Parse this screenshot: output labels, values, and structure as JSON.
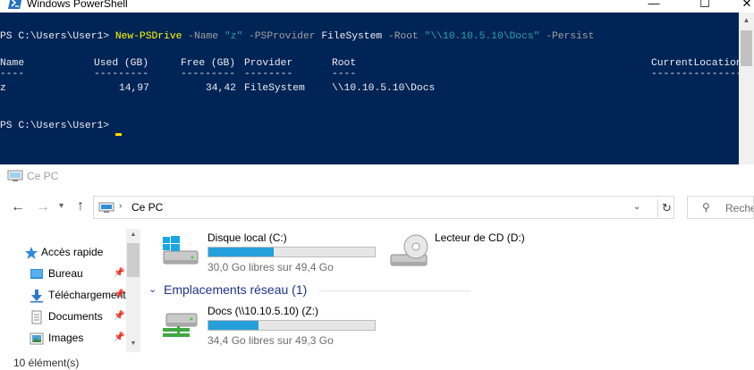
{
  "powershell": {
    "title": "Windows PowerShell",
    "window_buttons": {
      "minimize": "—",
      "maximize": "☐",
      "close": "✕"
    },
    "prompt": "PS C:\\Users\\User1>",
    "command": {
      "cmdlet": "New-PSDrive",
      "p1": "-Name",
      "v1": "\"z\"",
      "p2": "-PSProvider",
      "v2": "FileSystem",
      "p3": "-Root",
      "v3": "\"\\\\10.10.5.10\\Docs\"",
      "p4": "-Persist"
    },
    "table": {
      "headers": [
        "Name",
        "Used (GB)",
        "Free (GB)",
        "Provider",
        "Root",
        "CurrentLocation"
      ],
      "separators": [
        "----",
        "---------",
        "---------",
        "--------",
        "----",
        "---------------"
      ],
      "row": [
        "z",
        "14,97",
        "34,42",
        "FileSystem",
        "\\\\10.10.5.10\\Docs",
        ""
      ]
    },
    "prompt2": "PS C:\\Users\\User1>"
  },
  "explorer": {
    "title": "Ce PC",
    "address": {
      "path": "Ce PC"
    },
    "search": {
      "placeholder": "Rechercher dans : Ce PC"
    },
    "nav": [
      {
        "label": "Accès rapide",
        "icon": "star-icon",
        "pinned": false
      },
      {
        "label": "Bureau",
        "icon": "desktop-folder-icon",
        "pinned": true
      },
      {
        "label": "Téléchargements",
        "icon": "download-folder-icon",
        "pinned": true
      },
      {
        "label": "Documents",
        "icon": "documents-folder-icon",
        "pinned": true
      },
      {
        "label": "Images",
        "icon": "pictures-folder-icon",
        "pinned": true
      }
    ],
    "drives": [
      {
        "name": "Disque local (C:)",
        "free": "30,0 Go libres sur 49,4 Go",
        "used_fraction": 0.39
      },
      {
        "name": "Lecteur de CD (D:)",
        "free": "",
        "used_fraction": null
      }
    ],
    "network_group": {
      "title": "Emplacements réseau (1)",
      "items": [
        {
          "name": "Docs (\\\\10.10.5.10) (Z:)",
          "free": "34,4 Go libres sur 49,3 Go",
          "used_fraction": 0.3
        }
      ]
    },
    "status": "10 élément(s)"
  }
}
